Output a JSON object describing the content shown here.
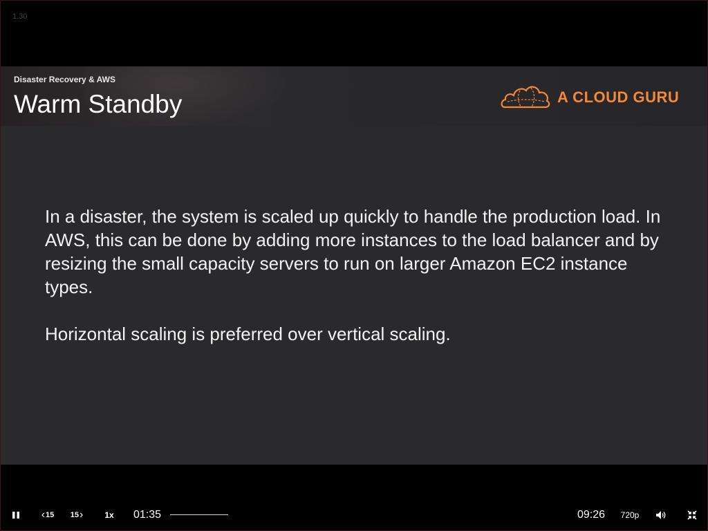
{
  "player": {
    "version": "1.30",
    "current_time": "01:35",
    "duration": "09:26",
    "quality": "720p",
    "speed": "1x",
    "rewind_label": "15",
    "forward_label": "15",
    "progress": 0.168
  },
  "slide": {
    "course": "Disaster Recovery & AWS",
    "title": "Warm Standby",
    "logo_text": "A CLOUD GURU",
    "brand_color": "#f3893a",
    "paragraph1": "In a disaster, the system is scaled up quickly to handle the production load. In AWS, this can be done by adding more instances to the load balancer and by resizing the small capacity servers to run on larger Amazon EC2 instance types.",
    "paragraph2": "Horizontal scaling is preferred over vertical scaling."
  },
  "icons": {
    "play_pause": "pause-icon",
    "rewind": "rewind-15-icon",
    "forward": "forward-15-icon",
    "volume": "volume-icon",
    "fullscreen": "exit-fullscreen-icon",
    "logo": "cloud-logo-icon"
  }
}
